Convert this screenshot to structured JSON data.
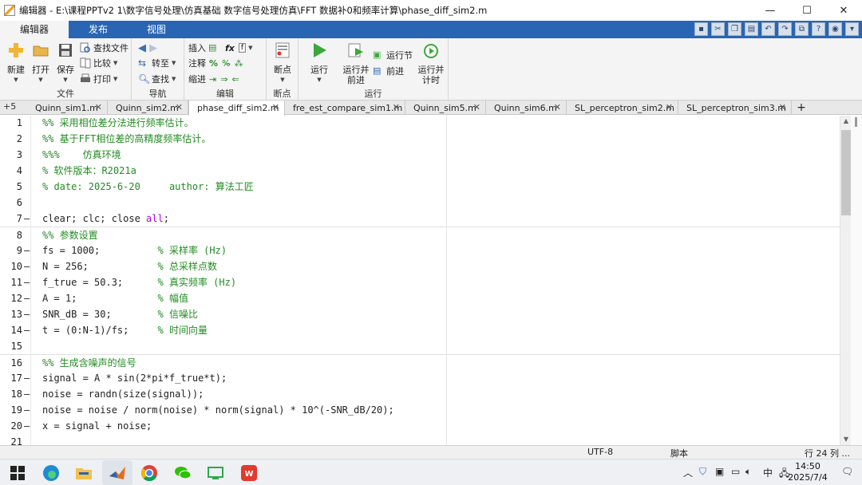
{
  "window": {
    "title": "编辑器 - E:\\课程PPTv2 1\\数字信号处理\\仿真基础  数字信号处理仿真\\FFT 数据补0和频率计算\\phase_diff_sim2.m",
    "minimize": "—",
    "maximize": "☐",
    "close": "✕"
  },
  "ribbon": {
    "tabs": [
      "编辑器",
      "发布",
      "视图"
    ],
    "active_tab": 0,
    "groups": {
      "file": {
        "label": "文件",
        "new": "新建",
        "open": "打开",
        "save": "保存",
        "find_files": "查找文件",
        "compare": "比较",
        "print": "打印"
      },
      "navigate": {
        "label": "导航",
        "goto": "转至",
        "find": "查找"
      },
      "edit": {
        "label": "编辑",
        "insert": "插入",
        "comment": "注释",
        "indent": "缩进"
      },
      "breakpoints": {
        "label": "断点",
        "breakpoints": "断点"
      },
      "run": {
        "label": "运行",
        "run": "运行",
        "run_advance": "运行并\n前进",
        "run_section": "运行节",
        "advance": "前进",
        "run_time": "运行并\n计时"
      }
    }
  },
  "doc_tabs": {
    "overflow": "+5",
    "tabs": [
      "Quinn_sim1.m",
      "Quinn_sim2.m",
      "phase_diff_sim2.m",
      "fre_est_compare_sim1.m",
      "Quinn_sim5.m",
      "Quinn_sim6.m",
      "SL_perceptron_sim2.m",
      "SL_perceptron_sim3.m"
    ],
    "active": 2,
    "add": "+"
  },
  "code": {
    "lines": [
      {
        "n": "1",
        "dash": "",
        "code": "",
        "comment": "%% 采用相位差分法进行频率估计。",
        "kw": ""
      },
      {
        "n": "2",
        "dash": "",
        "code": "",
        "comment": "%% 基于FFT相位差的高精度频率估计。",
        "kw": ""
      },
      {
        "n": "3",
        "dash": "",
        "code": "",
        "comment": "%%%    仿真环境",
        "kw": ""
      },
      {
        "n": "4",
        "dash": "",
        "code": "",
        "comment": "% 软件版本：R2021a",
        "kw": ""
      },
      {
        "n": "5",
        "dash": "",
        "code": "",
        "comment": "% date: 2025-6-20     author: 算法工匠",
        "kw": ""
      },
      {
        "n": "6",
        "dash": "",
        "code": "",
        "comment": "",
        "kw": ""
      },
      {
        "n": "7",
        "dash": "—",
        "code": "clear; clc; close ",
        "comment": "",
        "kw": "all",
        "after": ";"
      },
      {
        "n": "8",
        "dash": "",
        "code": "",
        "comment": "%% 参数设置",
        "kw": "",
        "section": true
      },
      {
        "n": "9",
        "dash": "—",
        "code": "fs = 1000;          ",
        "comment": "% 采样率 (Hz)",
        "kw": ""
      },
      {
        "n": "10",
        "dash": "—",
        "code": "N = 256;            ",
        "comment": "% 总采样点数",
        "kw": ""
      },
      {
        "n": "11",
        "dash": "—",
        "code": "f_true = 50.3;      ",
        "comment": "% 真实频率 (Hz)",
        "kw": ""
      },
      {
        "n": "12",
        "dash": "—",
        "code": "A = 1;              ",
        "comment": "% 幅值",
        "kw": ""
      },
      {
        "n": "13",
        "dash": "—",
        "code": "SNR_dB = 30;        ",
        "comment": "% 信噪比",
        "kw": ""
      },
      {
        "n": "14",
        "dash": "—",
        "code": "t = (0:N-1)/fs;     ",
        "comment": "% 时间向量",
        "kw": ""
      },
      {
        "n": "15",
        "dash": "",
        "code": "",
        "comment": "",
        "kw": ""
      },
      {
        "n": "16",
        "dash": "",
        "code": "",
        "comment": "%% 生成含噪声的信号",
        "kw": "",
        "section": true
      },
      {
        "n": "17",
        "dash": "—",
        "code": "signal = A * sin(2*pi*f_true*t);",
        "comment": "",
        "kw": ""
      },
      {
        "n": "18",
        "dash": "—",
        "code": "noise = randn(size(signal));",
        "comment": "",
        "kw": ""
      },
      {
        "n": "19",
        "dash": "—",
        "code": "noise = noise / norm(noise) * norm(signal) * 10^(-SNR_dB/20);",
        "comment": "",
        "kw": ""
      },
      {
        "n": "20",
        "dash": "—",
        "code": "x = signal + noise;",
        "comment": "",
        "kw": ""
      },
      {
        "n": "21",
        "dash": "",
        "code": "",
        "comment": "",
        "kw": ""
      }
    ]
  },
  "status": {
    "encoding": "UTF-8",
    "type": "脚本",
    "position": "行 24  列 ..."
  },
  "taskbar": {
    "tray_ime": "中",
    "time": "14:50",
    "date": "2025/7/4"
  },
  "colors": {
    "ribbon_blue": "#2a65b3",
    "comment_green": "#228b22",
    "keyword_purple": "#b000e0"
  }
}
